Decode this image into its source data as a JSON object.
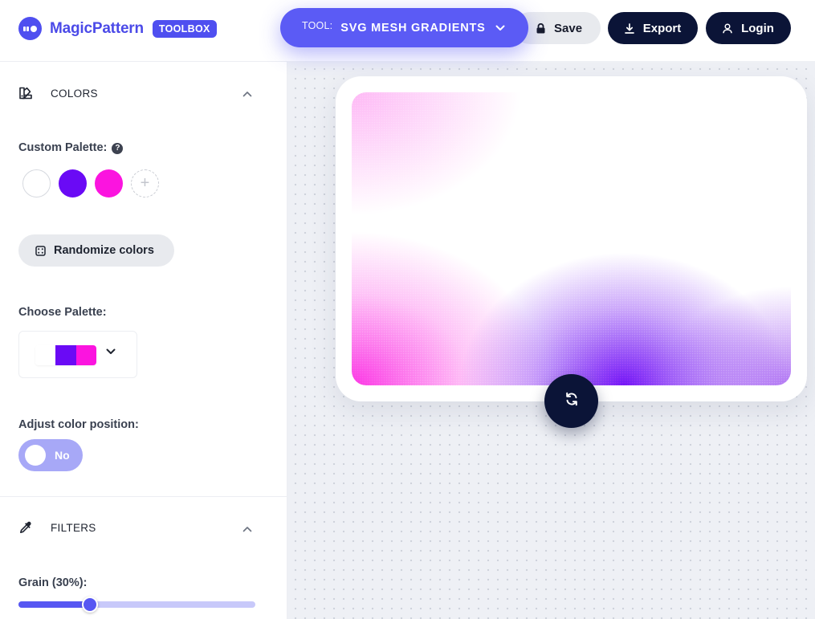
{
  "header": {
    "brand": "MagicPattern",
    "badge": "TOOLBOX",
    "tool_prefix": "TOOL:",
    "tool_name": "SVG MESH GRADIENTS",
    "save_label": "Save",
    "export_label": "Export",
    "login_label": "Login"
  },
  "sidebar": {
    "colors_section": {
      "title": "COLORS",
      "custom_palette_label": "Custom Palette:",
      "help": "?",
      "swatches": [
        "#ffffff",
        "#6a0af5",
        "#fb14df"
      ],
      "add_swatch": "+",
      "randomize_label": "Randomize colors",
      "choose_palette_label": "Choose Palette:",
      "selected_palette": [
        "#ffffff",
        "#6a0af5",
        "#fb14df"
      ],
      "adjust_position_label": "Adjust color position:",
      "adjust_position_value": "No"
    },
    "filters_section": {
      "title": "FILTERS",
      "grain_label": "Grain (30%):",
      "grain_value": 0.3
    }
  },
  "colors": {
    "accent": "#5b5bf5",
    "dark": "#0b1437",
    "purple": "#6a0af5",
    "pink": "#fb14df"
  },
  "icons": {
    "logo": "magicpattern-logo-icon",
    "tool_chevron": "chevron-down-icon",
    "save": "lock-icon",
    "export": "download-icon",
    "login": "user-icon",
    "colors": "palette-icon",
    "filters": "eyedropper-icon",
    "collapse": "chevron-up-icon",
    "randomize": "dice-icon",
    "palette_chevron": "chevron-down-icon",
    "refresh": "refresh-icon"
  }
}
